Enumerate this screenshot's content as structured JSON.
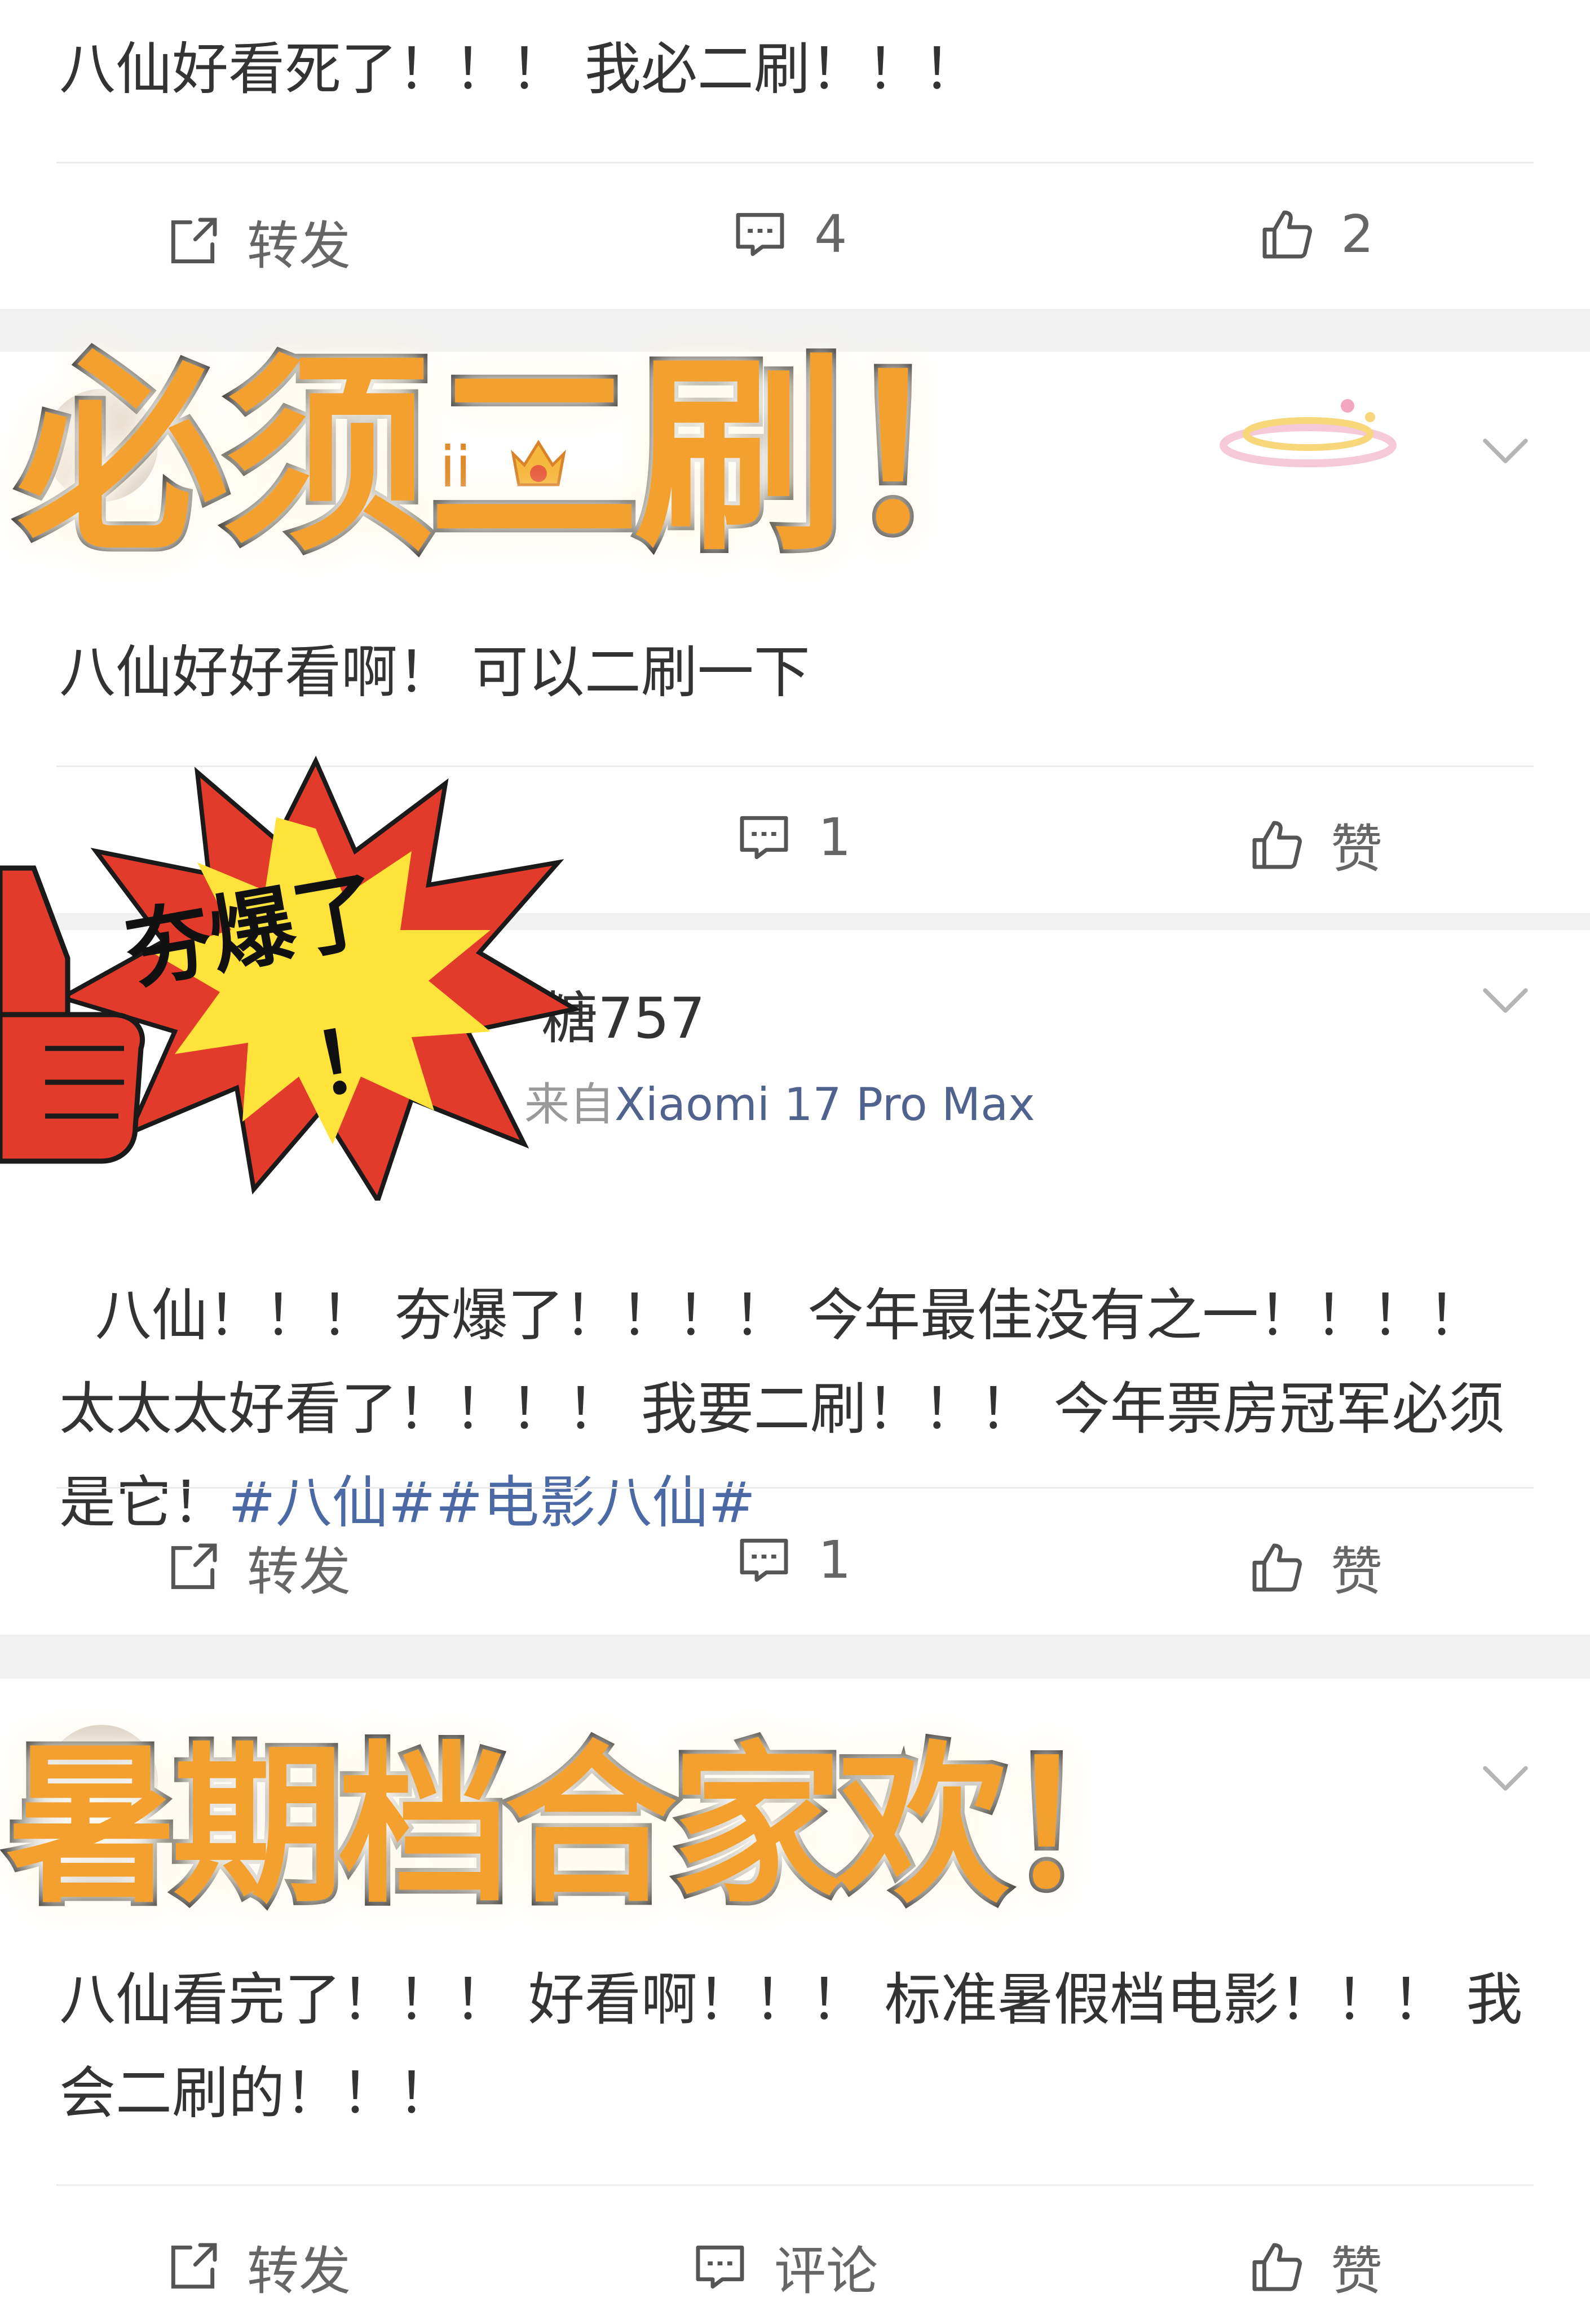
{
  "posts": [
    {
      "text": "八仙好看死了！！！ 我必二刷！！！",
      "actions": {
        "repost": "转发",
        "comment": "4",
        "like": "2"
      }
    },
    {
      "handle_suffix": "ii",
      "text": "八仙好好看啊！ 可以二刷一下",
      "actions": {
        "comment": "1",
        "like": "赞"
      }
    },
    {
      "handle_suffix": "糖757",
      "source_prefix": "来自",
      "source_device": "Xiaomi 17 Pro Max",
      "text": "八仙！！！ 夯爆了！！！！ 今年最佳没有之一！！！！ 太太太好看了！！！！ 我要二刷！！！ 今年票房冠军必须是它！",
      "hashtags": "#八仙##电影八仙#",
      "actions": {
        "repost": "转发",
        "comment": "1",
        "like": "赞"
      }
    },
    {
      "text": "八仙看完了！！！ 好看啊！！！ 标准暑假档电影！！！ 我会二刷的！！！",
      "actions": {
        "repost": "转发",
        "comment": "评论",
        "like": "赞"
      }
    }
  ],
  "stickers": {
    "top": "必须二刷！",
    "burst": "夯爆了",
    "burst_mark": "！",
    "bottom": "暑期档合家欢！"
  },
  "icons": [
    "repost-icon",
    "comment-icon",
    "like-icon",
    "chevron-down-icon",
    "crown-badge-icon"
  ],
  "colors": {
    "hashtag": "#4b6aa5",
    "sticker_fill": "#f4a02f",
    "burst_red": "#e23b2c",
    "burst_yellow": "#ffe23a"
  }
}
